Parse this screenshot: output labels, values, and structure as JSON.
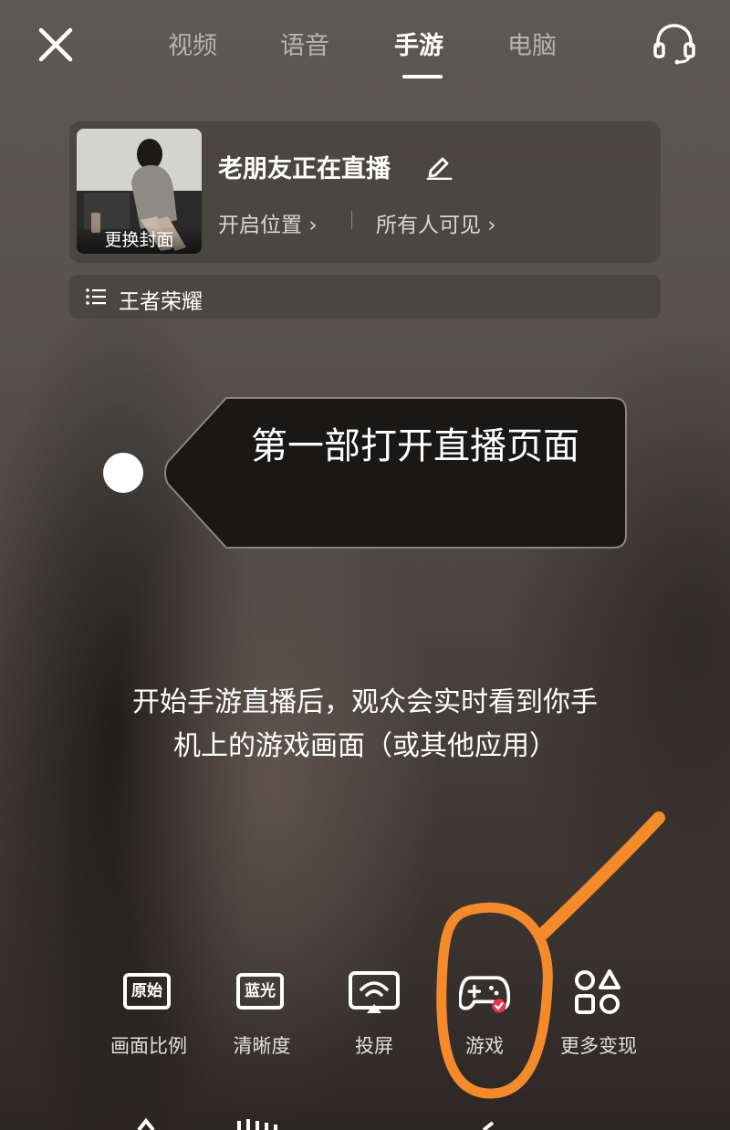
{
  "header": {
    "tabs": [
      {
        "label": "视频"
      },
      {
        "label": "语音"
      },
      {
        "label": "手游",
        "active": true
      },
      {
        "label": "电脑"
      }
    ],
    "icons": {
      "close": "close-icon",
      "support": "headset-icon"
    }
  },
  "live_card": {
    "cover_label": "更换封面",
    "title": "老朋友正在直播",
    "location": "开启位置",
    "visibility": "所有人可见"
  },
  "category": {
    "label": "王者荣耀",
    "icon": "list-icon"
  },
  "guide_tag": {
    "text": "第一部打开直播页面"
  },
  "description": "开始手游直播后，观众会实时看到你手机上的游戏画面（或其他应用）",
  "toolbar": {
    "items": [
      {
        "label": "画面比例",
        "icon_text": "原始",
        "icon": "aspect-ratio-icon"
      },
      {
        "label": "清晰度",
        "icon_text": "蓝光",
        "icon": "resolution-icon"
      },
      {
        "label": "投屏",
        "icon": "cast-screen-icon"
      },
      {
        "label": "游戏",
        "icon": "gamepad-icon"
      },
      {
        "label": "更多变现",
        "icon": "more-shapes-icon"
      }
    ]
  },
  "colors": {
    "annotation": "#f58a2a",
    "badge": "#e8344e"
  }
}
